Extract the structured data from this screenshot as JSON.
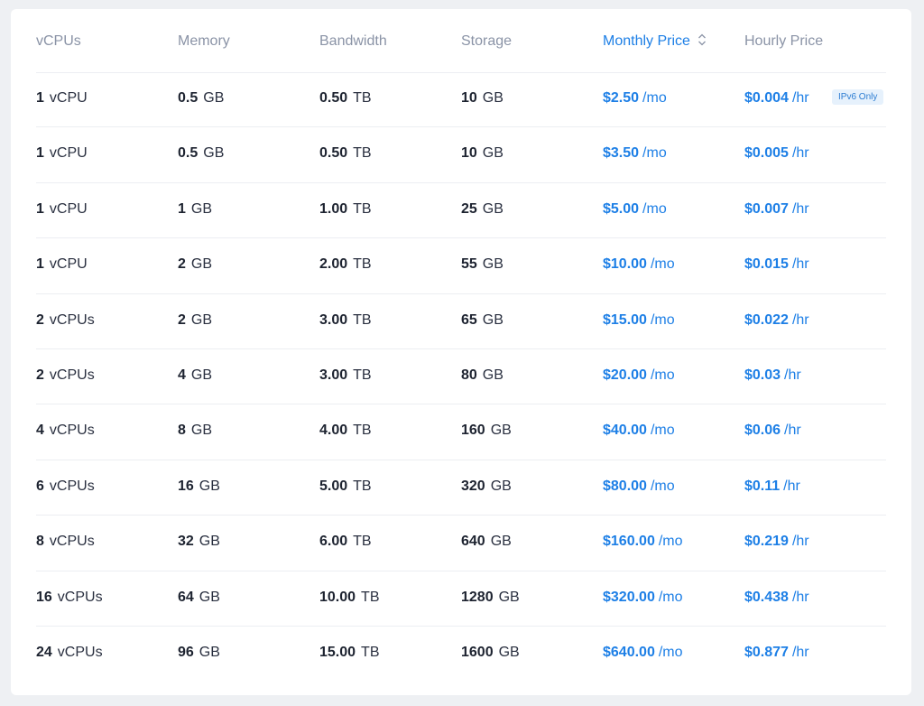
{
  "table": {
    "headers": [
      {
        "label": "vCPUs"
      },
      {
        "label": "Memory"
      },
      {
        "label": "Bandwidth"
      },
      {
        "label": "Storage"
      },
      {
        "label": "Monthly Price"
      },
      {
        "label": "Hourly Price"
      }
    ],
    "sorted_column": "Monthly Price",
    "accent_color": "#1d7fe6",
    "rows": [
      {
        "vcpu": "1",
        "vcpu_unit": "vCPU",
        "memory": "0.5",
        "memory_unit": "GB",
        "bandwidth": "0.50",
        "bandwidth_unit": "TB",
        "storage": "10",
        "storage_unit": "GB",
        "monthly": "$2.50",
        "monthly_unit": "/mo",
        "hourly": "$0.004",
        "hourly_unit": "/hr",
        "badge": "IPv6 Only"
      },
      {
        "vcpu": "1",
        "vcpu_unit": "vCPU",
        "memory": "0.5",
        "memory_unit": "GB",
        "bandwidth": "0.50",
        "bandwidth_unit": "TB",
        "storage": "10",
        "storage_unit": "GB",
        "monthly": "$3.50",
        "monthly_unit": "/mo",
        "hourly": "$0.005",
        "hourly_unit": "/hr"
      },
      {
        "vcpu": "1",
        "vcpu_unit": "vCPU",
        "memory": "1",
        "memory_unit": "GB",
        "bandwidth": "1.00",
        "bandwidth_unit": "TB",
        "storage": "25",
        "storage_unit": "GB",
        "monthly": "$5.00",
        "monthly_unit": "/mo",
        "hourly": "$0.007",
        "hourly_unit": "/hr"
      },
      {
        "vcpu": "1",
        "vcpu_unit": "vCPU",
        "memory": "2",
        "memory_unit": "GB",
        "bandwidth": "2.00",
        "bandwidth_unit": "TB",
        "storage": "55",
        "storage_unit": "GB",
        "monthly": "$10.00",
        "monthly_unit": "/mo",
        "hourly": "$0.015",
        "hourly_unit": "/hr"
      },
      {
        "vcpu": "2",
        "vcpu_unit": "vCPUs",
        "memory": "2",
        "memory_unit": "GB",
        "bandwidth": "3.00",
        "bandwidth_unit": "TB",
        "storage": "65",
        "storage_unit": "GB",
        "monthly": "$15.00",
        "monthly_unit": "/mo",
        "hourly": "$0.022",
        "hourly_unit": "/hr"
      },
      {
        "vcpu": "2",
        "vcpu_unit": "vCPUs",
        "memory": "4",
        "memory_unit": "GB",
        "bandwidth": "3.00",
        "bandwidth_unit": "TB",
        "storage": "80",
        "storage_unit": "GB",
        "monthly": "$20.00",
        "monthly_unit": "/mo",
        "hourly": "$0.03",
        "hourly_unit": "/hr"
      },
      {
        "vcpu": "4",
        "vcpu_unit": "vCPUs",
        "memory": "8",
        "memory_unit": "GB",
        "bandwidth": "4.00",
        "bandwidth_unit": "TB",
        "storage": "160",
        "storage_unit": "GB",
        "monthly": "$40.00",
        "monthly_unit": "/mo",
        "hourly": "$0.06",
        "hourly_unit": "/hr"
      },
      {
        "vcpu": "6",
        "vcpu_unit": "vCPUs",
        "memory": "16",
        "memory_unit": "GB",
        "bandwidth": "5.00",
        "bandwidth_unit": "TB",
        "storage": "320",
        "storage_unit": "GB",
        "monthly": "$80.00",
        "monthly_unit": "/mo",
        "hourly": "$0.11",
        "hourly_unit": "/hr"
      },
      {
        "vcpu": "8",
        "vcpu_unit": "vCPUs",
        "memory": "32",
        "memory_unit": "GB",
        "bandwidth": "6.00",
        "bandwidth_unit": "TB",
        "storage": "640",
        "storage_unit": "GB",
        "monthly": "$160.00",
        "monthly_unit": "/mo",
        "hourly": "$0.219",
        "hourly_unit": "/hr"
      },
      {
        "vcpu": "16",
        "vcpu_unit": "vCPUs",
        "memory": "64",
        "memory_unit": "GB",
        "bandwidth": "10.00",
        "bandwidth_unit": "TB",
        "storage": "1280",
        "storage_unit": "GB",
        "monthly": "$320.00",
        "monthly_unit": "/mo",
        "hourly": "$0.438",
        "hourly_unit": "/hr"
      },
      {
        "vcpu": "24",
        "vcpu_unit": "vCPUs",
        "memory": "96",
        "memory_unit": "GB",
        "bandwidth": "15.00",
        "bandwidth_unit": "TB",
        "storage": "1600",
        "storage_unit": "GB",
        "monthly": "$640.00",
        "monthly_unit": "/mo",
        "hourly": "$0.877",
        "hourly_unit": "/hr"
      }
    ]
  }
}
